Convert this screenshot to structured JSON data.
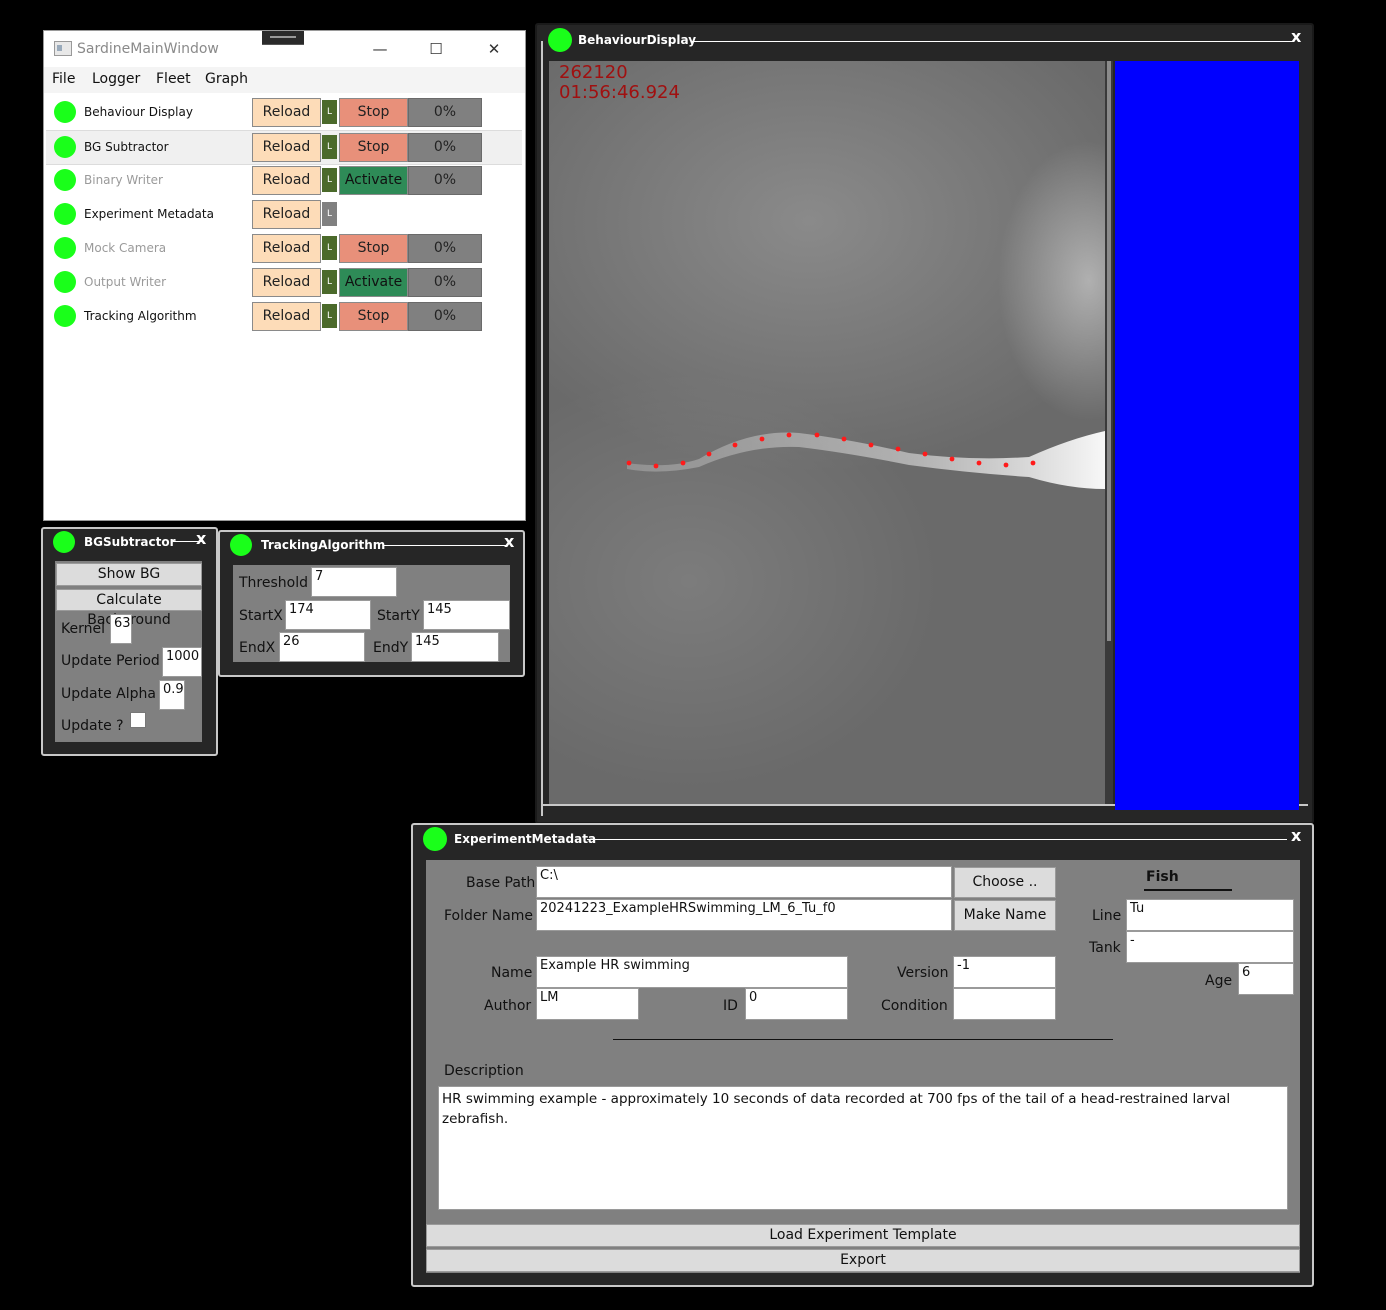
{
  "main_window": {
    "title": "SardineMainWindow",
    "controls": {
      "minimize": "—",
      "maximize": "☐",
      "close": "✕"
    },
    "menu": [
      "File",
      "Logger",
      "Fleet",
      "Graph"
    ],
    "modules": [
      {
        "name": "Behaviour Display",
        "reload": "Reload",
        "l": "L",
        "state": "Stop",
        "pct": "0%",
        "dimmed": false
      },
      {
        "name": "BG Subtractor",
        "reload": "Reload",
        "l": "L",
        "state": "Stop",
        "pct": "0%",
        "dimmed": false
      },
      {
        "name": "Binary Writer",
        "reload": "Reload",
        "l": "L",
        "state": "Activate",
        "pct": "0%",
        "dimmed": true
      },
      {
        "name": "Experiment Metadata",
        "reload": "Reload",
        "l": "L",
        "state": "",
        "pct": "",
        "dimmed": false
      },
      {
        "name": "Mock Camera",
        "reload": "Reload",
        "l": "L",
        "state": "Stop",
        "pct": "0%",
        "dimmed": true
      },
      {
        "name": "Output Writer",
        "reload": "Reload",
        "l": "L",
        "state": "Activate",
        "pct": "0%",
        "dimmed": true
      },
      {
        "name": "Tracking Algorithm",
        "reload": "Reload",
        "l": "L",
        "state": "Stop",
        "pct": "0%",
        "dimmed": false
      }
    ]
  },
  "bg_subtractor": {
    "title": "BGSubtractor",
    "close": "x",
    "show_bg": "Show BG",
    "calc_bg": "Calculate Background",
    "kernel_label": "Kernel",
    "kernel": "63",
    "update_period_label": "Update Period",
    "update_period": "1000",
    "update_alpha_label": "Update Alpha",
    "update_alpha": "0.9",
    "update_label": "Update ?",
    "update_checked": false
  },
  "tracking": {
    "title": "TrackingAlgorithm",
    "close": "x",
    "threshold_label": "Threshold",
    "threshold": "7",
    "startx_label": "StartX",
    "startx": "174",
    "starty_label": "StartY",
    "starty": "145",
    "endx_label": "EndX",
    "endx": "26",
    "endy_label": "EndY",
    "endy": "145"
  },
  "behaviour": {
    "title": "BehaviourDisplay",
    "close": "x",
    "frame": "262120",
    "timestamp": "01:56:46.924",
    "side_color": "#0000ff"
  },
  "metadata": {
    "title": "ExperimentMetadata",
    "close": "x",
    "base_path_label": "Base Path",
    "base_path": "C:\\",
    "choose": "Choose ..",
    "folder_label": "Folder Name",
    "folder": "20241223_ExampleHRSwimming_LM_6_Tu_f0",
    "make_name": "Make Name",
    "fish_header": "Fish",
    "line_label": "Line",
    "line": "Tu",
    "tank_label": "Tank",
    "tank": "-",
    "age_label": "Age",
    "age": "6",
    "name_label": "Name",
    "name": "Example HR swimming",
    "version_label": "Version",
    "version": "-1",
    "author_label": "Author",
    "author": "LM",
    "id_label": "ID",
    "id": "0",
    "condition_label": "Condition",
    "condition": "",
    "description_label": "Description",
    "description": "HR swimming example - approximately 10 seconds of data recorded at 700 fps of the tail of a head-restrained larval zebrafish.",
    "load_template": "Load Experiment Template",
    "export": "Export"
  }
}
